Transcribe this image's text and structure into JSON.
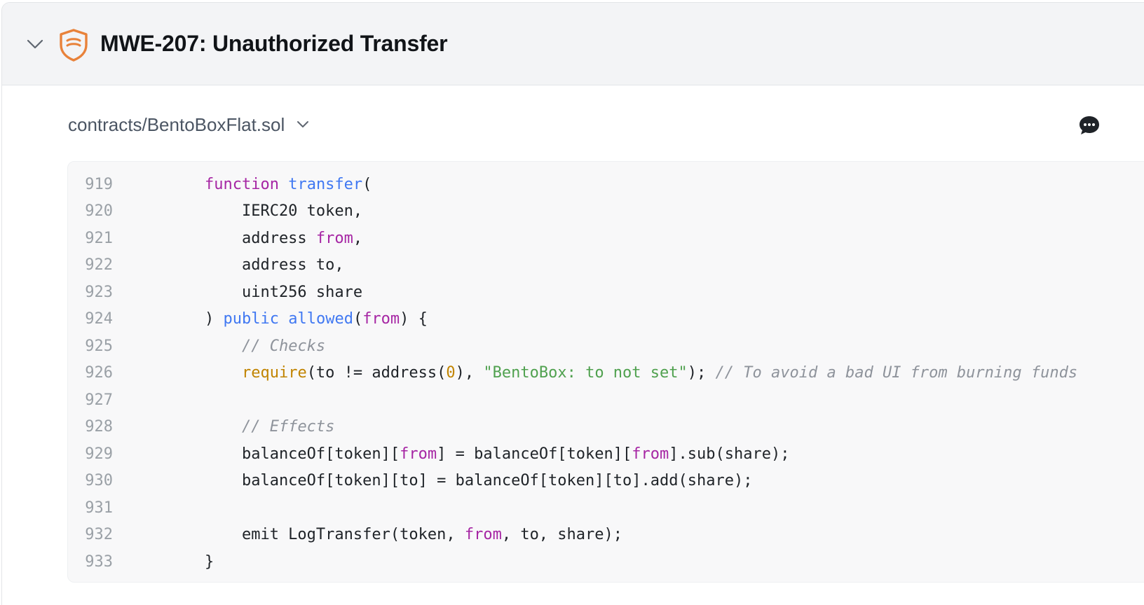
{
  "header": {
    "title": "MWE-207: Unauthorized Transfer",
    "toggle_icon": "chevron-down-icon",
    "badge_icon": "shield-icon",
    "accent_color": "#e8823a"
  },
  "file": {
    "name": "contracts/BentoBoxFlat.sol",
    "dropdown_icon": "chevron-down-icon",
    "comment_icon": "comment-bubble-icon"
  },
  "code": {
    "lines": [
      {
        "n": "919",
        "tokens": [
          [
            "pl",
            "    "
          ],
          [
            "kw",
            "function"
          ],
          [
            "pl",
            " "
          ],
          [
            "fn",
            "transfer"
          ],
          [
            "pl",
            "("
          ]
        ]
      },
      {
        "n": "920",
        "tokens": [
          [
            "pl",
            "        IERC20 token,"
          ]
        ]
      },
      {
        "n": "921",
        "tokens": [
          [
            "pl",
            "        address "
          ],
          [
            "kw",
            "from"
          ],
          [
            "pl",
            ","
          ]
        ]
      },
      {
        "n": "922",
        "tokens": [
          [
            "pl",
            "        address to,"
          ]
        ]
      },
      {
        "n": "923",
        "tokens": [
          [
            "pl",
            "        uint256 share"
          ]
        ]
      },
      {
        "n": "924",
        "tokens": [
          [
            "pl",
            "    ) "
          ],
          [
            "fn",
            "public"
          ],
          [
            "pl",
            " "
          ],
          [
            "fn",
            "allowed"
          ],
          [
            "pl",
            "("
          ],
          [
            "kw",
            "from"
          ],
          [
            "pl",
            ") {"
          ]
        ]
      },
      {
        "n": "925",
        "tokens": [
          [
            "pl",
            "        "
          ],
          [
            "cm",
            "// Checks"
          ]
        ]
      },
      {
        "n": "926",
        "tokens": [
          [
            "pl",
            "        "
          ],
          [
            "bi",
            "require"
          ],
          [
            "pl",
            "(to != address("
          ],
          [
            "num",
            "0"
          ],
          [
            "pl",
            "), "
          ],
          [
            "str",
            "\"BentoBox: to not set\""
          ],
          [
            "pl",
            "); "
          ],
          [
            "cm",
            "// To avoid a bad UI from burning funds"
          ]
        ]
      },
      {
        "n": "927",
        "tokens": []
      },
      {
        "n": "928",
        "tokens": [
          [
            "pl",
            "        "
          ],
          [
            "cm",
            "// Effects"
          ]
        ]
      },
      {
        "n": "929",
        "tokens": [
          [
            "pl",
            "        balanceOf[token]["
          ],
          [
            "kw",
            "from"
          ],
          [
            "pl",
            "] = balanceOf[token]["
          ],
          [
            "kw",
            "from"
          ],
          [
            "pl",
            "].sub(share);"
          ]
        ]
      },
      {
        "n": "930",
        "tokens": [
          [
            "pl",
            "        balanceOf[token][to] = balanceOf[token][to].add(share);"
          ]
        ]
      },
      {
        "n": "931",
        "tokens": []
      },
      {
        "n": "932",
        "tokens": [
          [
            "pl",
            "        emit LogTransfer(token, "
          ],
          [
            "kw",
            "from"
          ],
          [
            "pl",
            ", to, share);"
          ]
        ]
      },
      {
        "n": "933",
        "tokens": [
          [
            "pl",
            "    }"
          ]
        ]
      }
    ]
  }
}
